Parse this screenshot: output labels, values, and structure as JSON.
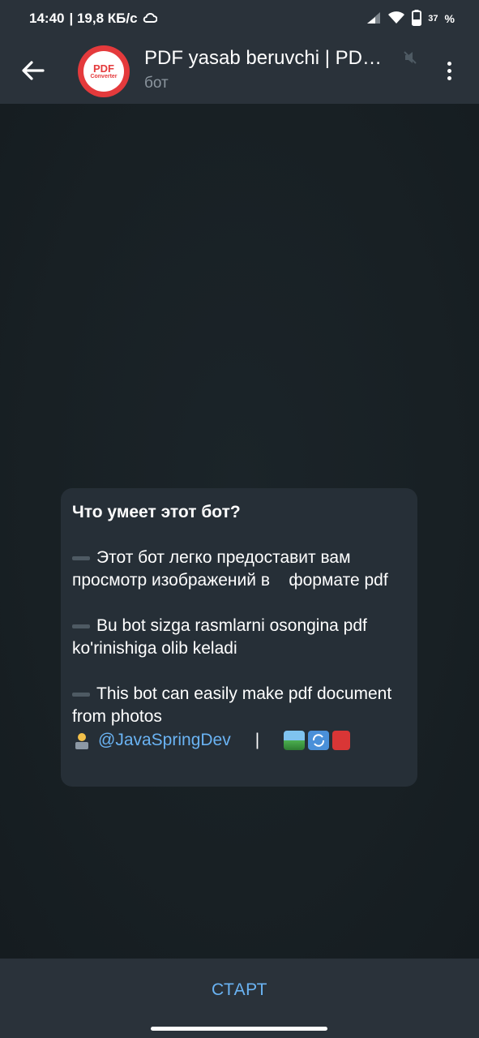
{
  "status_bar": {
    "time": "14:40",
    "speed": "| 19,8 КБ/с",
    "battery": "37",
    "battery_unit": "%"
  },
  "header": {
    "title": "PDF yasab beruvchi | PD…",
    "subtitle": "бот",
    "avatar_text": "PDF",
    "avatar_subtext": "Converter"
  },
  "bot_card": {
    "title": "Что умеет этот бот?",
    "para_ru": "Этот бот легко предоставит вам просмотр изображений в    формате pdf",
    "para_uz": "Bu bot sizga rasmlarni osongina pdf ko'rinishiga olib keladi",
    "para_en": "This bot can easily make pdf document from photos",
    "mention": "@JavaSpringDev",
    "separator": "|"
  },
  "bottom": {
    "start_label": "СТАРТ"
  },
  "colors": {
    "accent": "#6ab3f3",
    "header_bg": "#2a323a",
    "card_bg": "#262f37",
    "avatar_red": "#e43a3c"
  }
}
